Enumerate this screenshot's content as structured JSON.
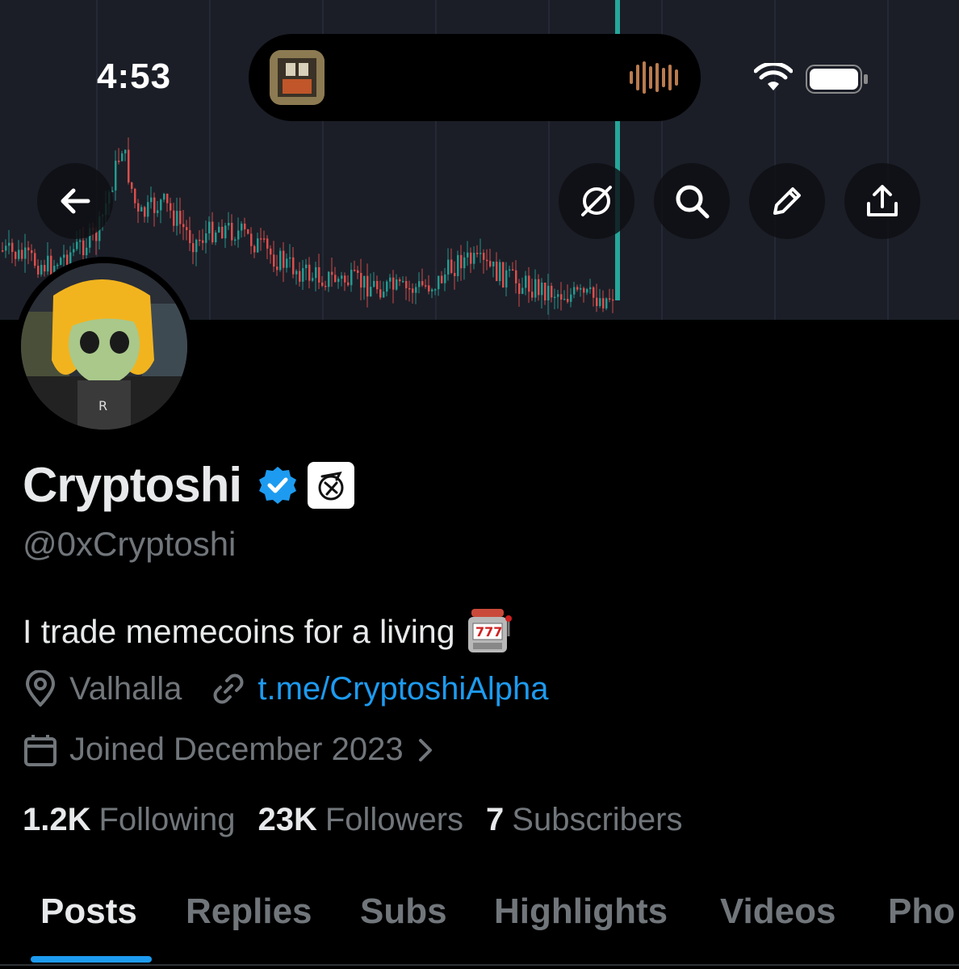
{
  "status_bar": {
    "time": "4:53"
  },
  "header": {
    "back_icon": "arrow-left-icon",
    "actions": [
      "grok-icon",
      "search-icon",
      "edit-icon",
      "share-icon"
    ]
  },
  "profile": {
    "name": "Cryptoshi",
    "handle": "@0xCryptoshi",
    "bio": "I trade memecoins for a living",
    "bio_emoji": "slot-machine-icon",
    "location": "Valhalla",
    "link": "t.me/CryptoshiAlpha",
    "joined": "Joined December 2023"
  },
  "stats": [
    {
      "value": "1.2K",
      "label": "Following"
    },
    {
      "value": "23K",
      "label": "Followers"
    },
    {
      "value": "7",
      "label": "Subscribers"
    }
  ],
  "tabs": [
    {
      "label": "Posts",
      "active": true
    },
    {
      "label": "Replies",
      "active": false
    },
    {
      "label": "Subs",
      "active": false
    },
    {
      "label": "Highlights",
      "active": false
    },
    {
      "label": "Videos",
      "active": false
    },
    {
      "label": "Pho",
      "active": false
    }
  ],
  "colors": {
    "accent": "#1d9bf0",
    "muted": "#71767b",
    "text": "#e7e9ea",
    "background": "#000000",
    "candle_up": "#26a69a",
    "candle_down": "#ef5350"
  }
}
